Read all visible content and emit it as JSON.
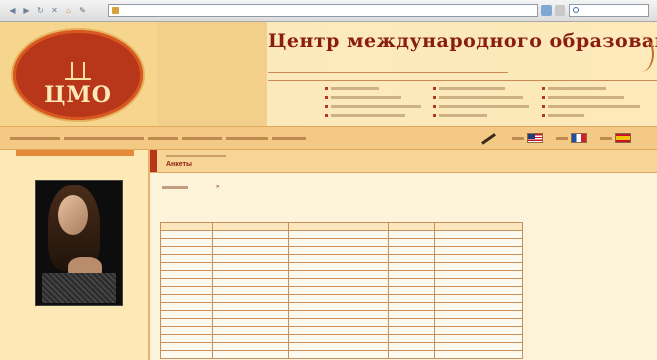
{
  "browser": {
    "url": "",
    "search_placeholder": ""
  },
  "header": {
    "logo_text": "ЦМО",
    "title": "Центр международного образования",
    "slogan": "",
    "slogan_right": "",
    "nav_columns": [
      [
        "",
        "",
        "",
        ""
      ],
      [
        "",
        "",
        "",
        ""
      ],
      [
        "",
        "",
        "",
        ""
      ]
    ]
  },
  "crumbbar": {
    "languages": [
      {
        "code": "us",
        "label": ""
      },
      {
        "code": "fr",
        "label": ""
      },
      {
        "code": "es",
        "label": ""
      }
    ]
  },
  "main": {
    "breadcrumb": "",
    "title": "Анкеты",
    "pager": {
      "label": "",
      "pages": [
        "",
        ""
      ]
    },
    "table_label": "",
    "table": {
      "columns": [
        "",
        "",
        "",
        "",
        ""
      ],
      "rows": [
        [
          "",
          "",
          "",
          "",
          ""
        ],
        [
          "",
          "",
          "",
          "",
          ""
        ],
        [
          "",
          "",
          "",
          "",
          ""
        ],
        [
          "",
          "",
          "",
          "",
          ""
        ],
        [
          "",
          "",
          "",
          "",
          ""
        ],
        [
          "",
          "",
          "",
          "",
          ""
        ],
        [
          "",
          "",
          "",
          "",
          ""
        ],
        [
          "",
          "",
          "",
          "",
          ""
        ],
        [
          "",
          "",
          "",
          "",
          ""
        ],
        [
          "",
          "",
          "",
          "",
          ""
        ],
        [
          "",
          "",
          "",
          "",
          ""
        ],
        [
          "",
          "",
          "",
          "",
          ""
        ],
        [
          "",
          "",
          "",
          "",
          ""
        ],
        [
          "",
          "",
          "",
          "",
          ""
        ],
        [
          "",
          "",
          "",
          "",
          ""
        ],
        [
          "",
          "",
          "",
          "",
          ""
        ]
      ]
    }
  },
  "colors": {
    "brand_red": "#b8361a",
    "title_red": "#8a1d10",
    "cream": "#fbe7b6",
    "table_border": "#c9905c"
  },
  "icons": {
    "back": "back-arrow-icon",
    "forward": "forward-arrow-icon",
    "reload": "reload-icon",
    "stop": "stop-icon",
    "home": "home-icon",
    "edit": "edit-pen-icon"
  }
}
